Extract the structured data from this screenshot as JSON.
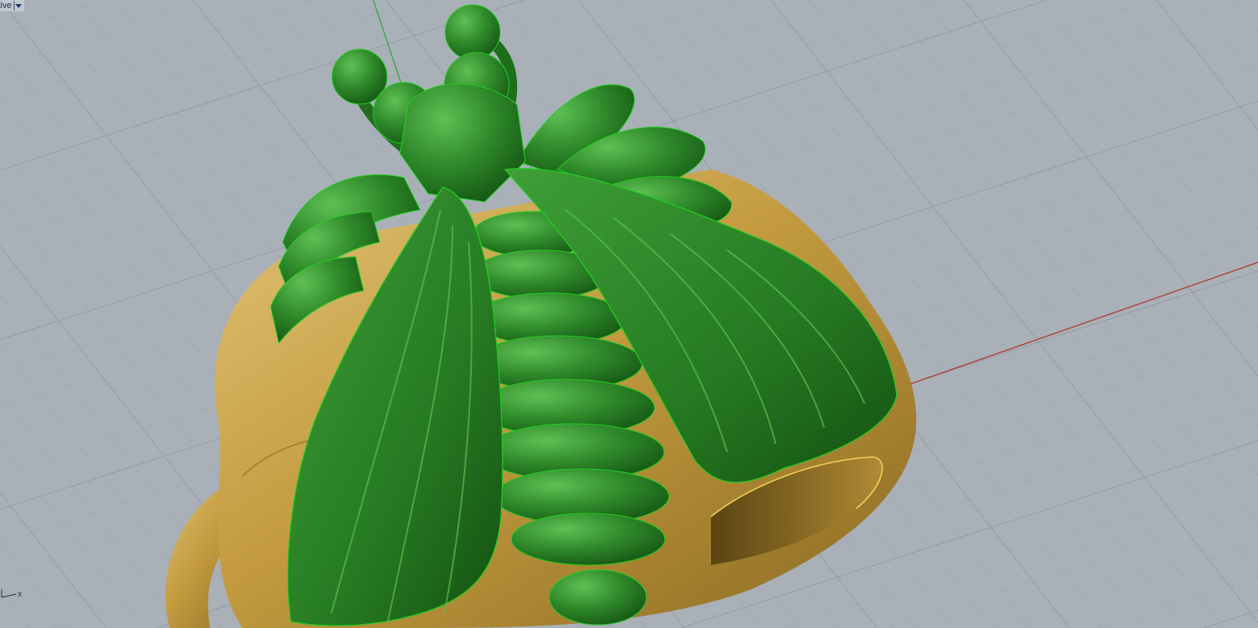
{
  "viewport": {
    "name": "ctive",
    "axis_label_x": "x"
  },
  "colors": {
    "background": "#a9b0b8",
    "grid_minor": "#9ca3ab",
    "grid_major": "#8e959e",
    "axis_x": "#b03a2e",
    "axis_y": "#2fa83a",
    "ring_gold": "#c9a24a",
    "bee_green": "#2f8a2a",
    "edge_green": "#1fd11f"
  },
  "icons": {
    "viewport_menu": "triangle-down-icon",
    "axis_widget": "axis-triad-icon"
  }
}
